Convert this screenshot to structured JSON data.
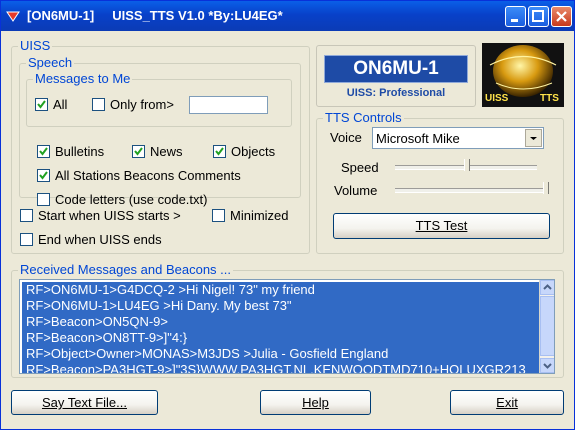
{
  "window": {
    "title": "[ON6MU-1]     UISS_TTS V1.0 *By:LU4EG*"
  },
  "uiss": {
    "legend": "UISS",
    "speech": {
      "legend": "Speech",
      "messages_to_me": {
        "legend": "Messages to Me",
        "all_label": "All",
        "all_checked": true,
        "only_from_label": "Only from>",
        "only_from_checked": false,
        "only_from_value": ""
      },
      "bulletins_label": "Bulletins",
      "news_label": "News",
      "objects_label": "Objects",
      "beacons_label": "All Stations Beacons Comments",
      "code_letters_label": "Code letters (use code.txt)"
    },
    "start_label": "Start when UISS starts >",
    "minimized_label": "Minimized",
    "end_label": "End when UISS ends"
  },
  "callsign": {
    "value": "ON6MU-1",
    "edition": "UISS: Professional"
  },
  "logo": {
    "left": "UISS",
    "right": "TTS"
  },
  "tts": {
    "legend": "TTS Controls",
    "voice_label": "Voice",
    "voice_value": "Microsoft Mike",
    "speed_label": "Speed",
    "speed_value": 0.5,
    "volume_label": "Volume",
    "volume_value": 1.0,
    "test_button": "TTS Test"
  },
  "received": {
    "legend": "Received Messages and Beacons ...",
    "rows": [
      "RF>ON6MU-1>G4DCQ-2  >Hi Nigel! 73\" my friend",
      "RF>ON6MU-1>LU4EG    >Hi Dany. My best 73\"",
      "RF>Beacon>ON5QN-9>",
      "RF>Beacon>ON8TT-9>]\"4:}",
      "RF>Object>Owner>MONAS>M3JDS     >Julia - Gosfield England",
      "RF>Beacon>PA3HGT-9>]\"3S}WWW.PA3HGT.NL,KENWOODTMD710+HOLUXGR213"
    ]
  },
  "buttons": {
    "say_text": "Say Text File...",
    "help": "Help",
    "exit": "Exit"
  }
}
